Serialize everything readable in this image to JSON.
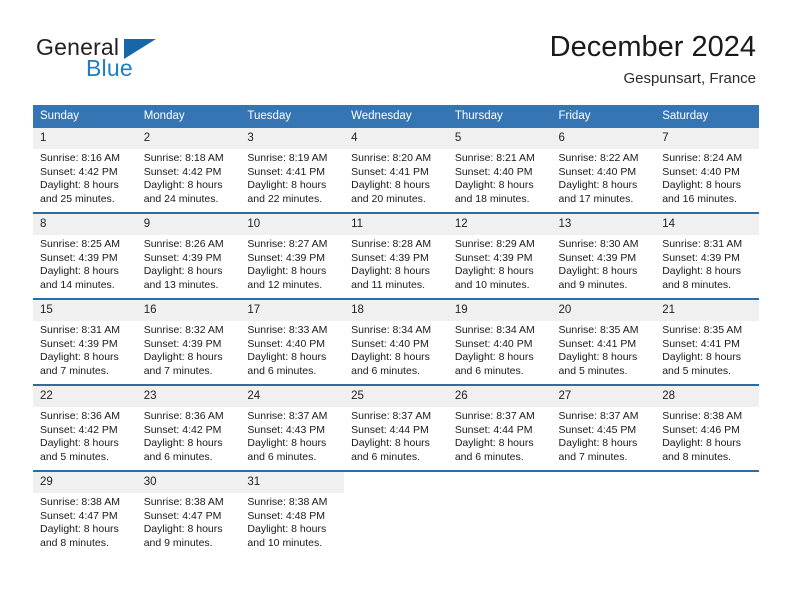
{
  "brand": {
    "name_part1": "General",
    "name_part2": "Blue"
  },
  "header": {
    "title": "December 2024",
    "subtitle": "Gespunsart, France"
  },
  "calendar": {
    "weekday_headers": [
      "Sunday",
      "Monday",
      "Tuesday",
      "Wednesday",
      "Thursday",
      "Friday",
      "Saturday"
    ],
    "colors": {
      "header_background": "#3575b4",
      "header_text": "#ffffff",
      "row_divider": "#2e6da4",
      "daynumber_background": "#f0f0f0",
      "brand_blue": "#1d7fc3"
    },
    "weeks": [
      [
        {
          "day": "1",
          "sunrise": "Sunrise: 8:16 AM",
          "sunset": "Sunset: 4:42 PM",
          "daylight_line1": "Daylight: 8 hours",
          "daylight_line2": "and 25 minutes."
        },
        {
          "day": "2",
          "sunrise": "Sunrise: 8:18 AM",
          "sunset": "Sunset: 4:42 PM",
          "daylight_line1": "Daylight: 8 hours",
          "daylight_line2": "and 24 minutes."
        },
        {
          "day": "3",
          "sunrise": "Sunrise: 8:19 AM",
          "sunset": "Sunset: 4:41 PM",
          "daylight_line1": "Daylight: 8 hours",
          "daylight_line2": "and 22 minutes."
        },
        {
          "day": "4",
          "sunrise": "Sunrise: 8:20 AM",
          "sunset": "Sunset: 4:41 PM",
          "daylight_line1": "Daylight: 8 hours",
          "daylight_line2": "and 20 minutes."
        },
        {
          "day": "5",
          "sunrise": "Sunrise: 8:21 AM",
          "sunset": "Sunset: 4:40 PM",
          "daylight_line1": "Daylight: 8 hours",
          "daylight_line2": "and 18 minutes."
        },
        {
          "day": "6",
          "sunrise": "Sunrise: 8:22 AM",
          "sunset": "Sunset: 4:40 PM",
          "daylight_line1": "Daylight: 8 hours",
          "daylight_line2": "and 17 minutes."
        },
        {
          "day": "7",
          "sunrise": "Sunrise: 8:24 AM",
          "sunset": "Sunset: 4:40 PM",
          "daylight_line1": "Daylight: 8 hours",
          "daylight_line2": "and 16 minutes."
        }
      ],
      [
        {
          "day": "8",
          "sunrise": "Sunrise: 8:25 AM",
          "sunset": "Sunset: 4:39 PM",
          "daylight_line1": "Daylight: 8 hours",
          "daylight_line2": "and 14 minutes."
        },
        {
          "day": "9",
          "sunrise": "Sunrise: 8:26 AM",
          "sunset": "Sunset: 4:39 PM",
          "daylight_line1": "Daylight: 8 hours",
          "daylight_line2": "and 13 minutes."
        },
        {
          "day": "10",
          "sunrise": "Sunrise: 8:27 AM",
          "sunset": "Sunset: 4:39 PM",
          "daylight_line1": "Daylight: 8 hours",
          "daylight_line2": "and 12 minutes."
        },
        {
          "day": "11",
          "sunrise": "Sunrise: 8:28 AM",
          "sunset": "Sunset: 4:39 PM",
          "daylight_line1": "Daylight: 8 hours",
          "daylight_line2": "and 11 minutes."
        },
        {
          "day": "12",
          "sunrise": "Sunrise: 8:29 AM",
          "sunset": "Sunset: 4:39 PM",
          "daylight_line1": "Daylight: 8 hours",
          "daylight_line2": "and 10 minutes."
        },
        {
          "day": "13",
          "sunrise": "Sunrise: 8:30 AM",
          "sunset": "Sunset: 4:39 PM",
          "daylight_line1": "Daylight: 8 hours",
          "daylight_line2": "and 9 minutes."
        },
        {
          "day": "14",
          "sunrise": "Sunrise: 8:31 AM",
          "sunset": "Sunset: 4:39 PM",
          "daylight_line1": "Daylight: 8 hours",
          "daylight_line2": "and 8 minutes."
        }
      ],
      [
        {
          "day": "15",
          "sunrise": "Sunrise: 8:31 AM",
          "sunset": "Sunset: 4:39 PM",
          "daylight_line1": "Daylight: 8 hours",
          "daylight_line2": "and 7 minutes."
        },
        {
          "day": "16",
          "sunrise": "Sunrise: 8:32 AM",
          "sunset": "Sunset: 4:39 PM",
          "daylight_line1": "Daylight: 8 hours",
          "daylight_line2": "and 7 minutes."
        },
        {
          "day": "17",
          "sunrise": "Sunrise: 8:33 AM",
          "sunset": "Sunset: 4:40 PM",
          "daylight_line1": "Daylight: 8 hours",
          "daylight_line2": "and 6 minutes."
        },
        {
          "day": "18",
          "sunrise": "Sunrise: 8:34 AM",
          "sunset": "Sunset: 4:40 PM",
          "daylight_line1": "Daylight: 8 hours",
          "daylight_line2": "and 6 minutes."
        },
        {
          "day": "19",
          "sunrise": "Sunrise: 8:34 AM",
          "sunset": "Sunset: 4:40 PM",
          "daylight_line1": "Daylight: 8 hours",
          "daylight_line2": "and 6 minutes."
        },
        {
          "day": "20",
          "sunrise": "Sunrise: 8:35 AM",
          "sunset": "Sunset: 4:41 PM",
          "daylight_line1": "Daylight: 8 hours",
          "daylight_line2": "and 5 minutes."
        },
        {
          "day": "21",
          "sunrise": "Sunrise: 8:35 AM",
          "sunset": "Sunset: 4:41 PM",
          "daylight_line1": "Daylight: 8 hours",
          "daylight_line2": "and 5 minutes."
        }
      ],
      [
        {
          "day": "22",
          "sunrise": "Sunrise: 8:36 AM",
          "sunset": "Sunset: 4:42 PM",
          "daylight_line1": "Daylight: 8 hours",
          "daylight_line2": "and 5 minutes."
        },
        {
          "day": "23",
          "sunrise": "Sunrise: 8:36 AM",
          "sunset": "Sunset: 4:42 PM",
          "daylight_line1": "Daylight: 8 hours",
          "daylight_line2": "and 6 minutes."
        },
        {
          "day": "24",
          "sunrise": "Sunrise: 8:37 AM",
          "sunset": "Sunset: 4:43 PM",
          "daylight_line1": "Daylight: 8 hours",
          "daylight_line2": "and 6 minutes."
        },
        {
          "day": "25",
          "sunrise": "Sunrise: 8:37 AM",
          "sunset": "Sunset: 4:44 PM",
          "daylight_line1": "Daylight: 8 hours",
          "daylight_line2": "and 6 minutes."
        },
        {
          "day": "26",
          "sunrise": "Sunrise: 8:37 AM",
          "sunset": "Sunset: 4:44 PM",
          "daylight_line1": "Daylight: 8 hours",
          "daylight_line2": "and 6 minutes."
        },
        {
          "day": "27",
          "sunrise": "Sunrise: 8:37 AM",
          "sunset": "Sunset: 4:45 PM",
          "daylight_line1": "Daylight: 8 hours",
          "daylight_line2": "and 7 minutes."
        },
        {
          "day": "28",
          "sunrise": "Sunrise: 8:38 AM",
          "sunset": "Sunset: 4:46 PM",
          "daylight_line1": "Daylight: 8 hours",
          "daylight_line2": "and 8 minutes."
        }
      ],
      [
        {
          "day": "29",
          "sunrise": "Sunrise: 8:38 AM",
          "sunset": "Sunset: 4:47 PM",
          "daylight_line1": "Daylight: 8 hours",
          "daylight_line2": "and 8 minutes."
        },
        {
          "day": "30",
          "sunrise": "Sunrise: 8:38 AM",
          "sunset": "Sunset: 4:47 PM",
          "daylight_line1": "Daylight: 8 hours",
          "daylight_line2": "and 9 minutes."
        },
        {
          "day": "31",
          "sunrise": "Sunrise: 8:38 AM",
          "sunset": "Sunset: 4:48 PM",
          "daylight_line1": "Daylight: 8 hours",
          "daylight_line2": "and 10 minutes."
        },
        {
          "day": "",
          "sunrise": "",
          "sunset": "",
          "daylight_line1": "",
          "daylight_line2": ""
        },
        {
          "day": "",
          "sunrise": "",
          "sunset": "",
          "daylight_line1": "",
          "daylight_line2": ""
        },
        {
          "day": "",
          "sunrise": "",
          "sunset": "",
          "daylight_line1": "",
          "daylight_line2": ""
        },
        {
          "day": "",
          "sunrise": "",
          "sunset": "",
          "daylight_line1": "",
          "daylight_line2": ""
        }
      ]
    ]
  }
}
